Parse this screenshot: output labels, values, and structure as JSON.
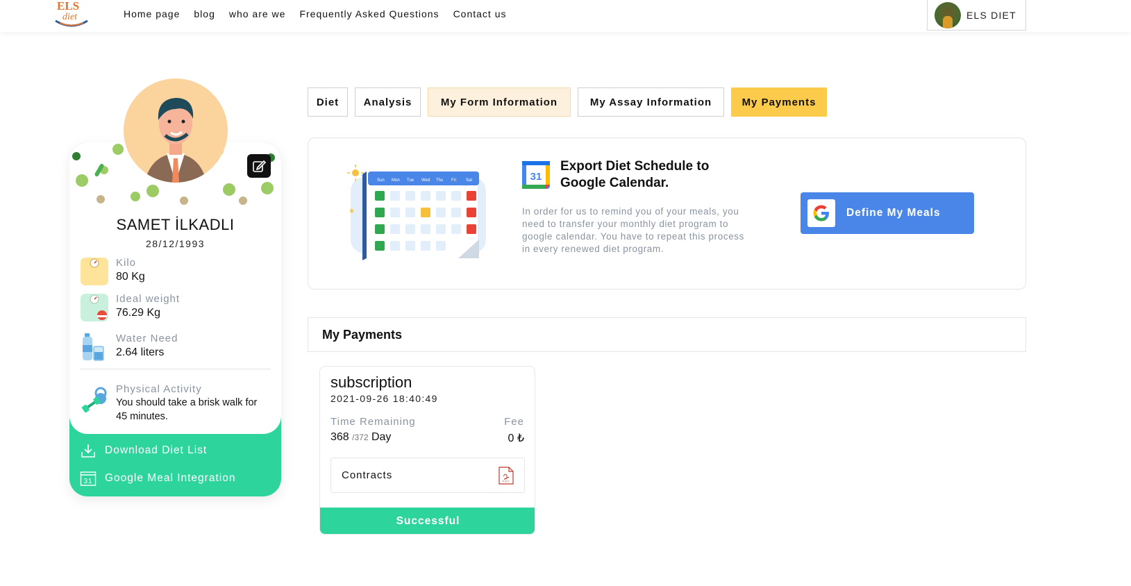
{
  "header": {
    "logo_text_top": "ELS",
    "logo_text_bottom": "diet",
    "nav": [
      {
        "label": "Home page"
      },
      {
        "label": "blog"
      },
      {
        "label": "who are we"
      },
      {
        "label": "Frequently Asked Questions"
      },
      {
        "label": "Contact us"
      }
    ],
    "user_name": "ELS DIET"
  },
  "profile": {
    "name": "SAMET İLKADLI",
    "dob": "28/12/1993",
    "stats": [
      {
        "label": "Kilo",
        "value": "80 Kg",
        "icon": "scale-icon"
      },
      {
        "label": "Ideal weight",
        "value": "76.29 Kg",
        "icon": "ideal-weight-icon"
      },
      {
        "label": "Water Need",
        "value": "2.64 liters",
        "icon": "water-bottle-icon"
      }
    ],
    "activity": {
      "label": "Physical Activity",
      "text": "You should take a brisk walk for 45 minutes.",
      "icon": "dumbbell-icon"
    },
    "links": [
      {
        "label": "Download Diet List",
        "icon": "download-icon"
      },
      {
        "label": "Google Meal Integration",
        "icon": "calendar-31-icon"
      }
    ]
  },
  "tabs": [
    {
      "label": "Diet"
    },
    {
      "label": "Analysis"
    },
    {
      "label": "My Form Information"
    },
    {
      "label": "My Assay Information"
    },
    {
      "label": "My Payments"
    }
  ],
  "export": {
    "calendar_days": [
      "Sun",
      "Mon",
      "Tue",
      "Wed",
      "Thu",
      "Fri",
      "Sat"
    ],
    "gcal_number": "31",
    "title": "Export Diet Schedule to Google Calendar.",
    "description": "In order for us to remind you of your meals, you need to transfer your monthly diet program to google calendar. You have to repeat this process in every renewed diet program.",
    "button_label": "Define My Meals"
  },
  "payments": {
    "header": "My Payments",
    "cards": [
      {
        "type": "subscription",
        "date": "2021-09-26 18:40:49",
        "time_remaining_label": "Time Remaining",
        "fee_label": "Fee",
        "remaining_days": "368",
        "total_days": "/372",
        "day_unit": "Day",
        "fee": "0 ₺",
        "contracts_label": "Contracts",
        "status": "Successful",
        "status_color": "#2dd59c"
      }
    ]
  },
  "colors": {
    "accent_green": "#2dd59c",
    "active_tab": "#fccb4b",
    "form_tab": "#fdf0dc",
    "google_blue": "#4a86e8"
  }
}
